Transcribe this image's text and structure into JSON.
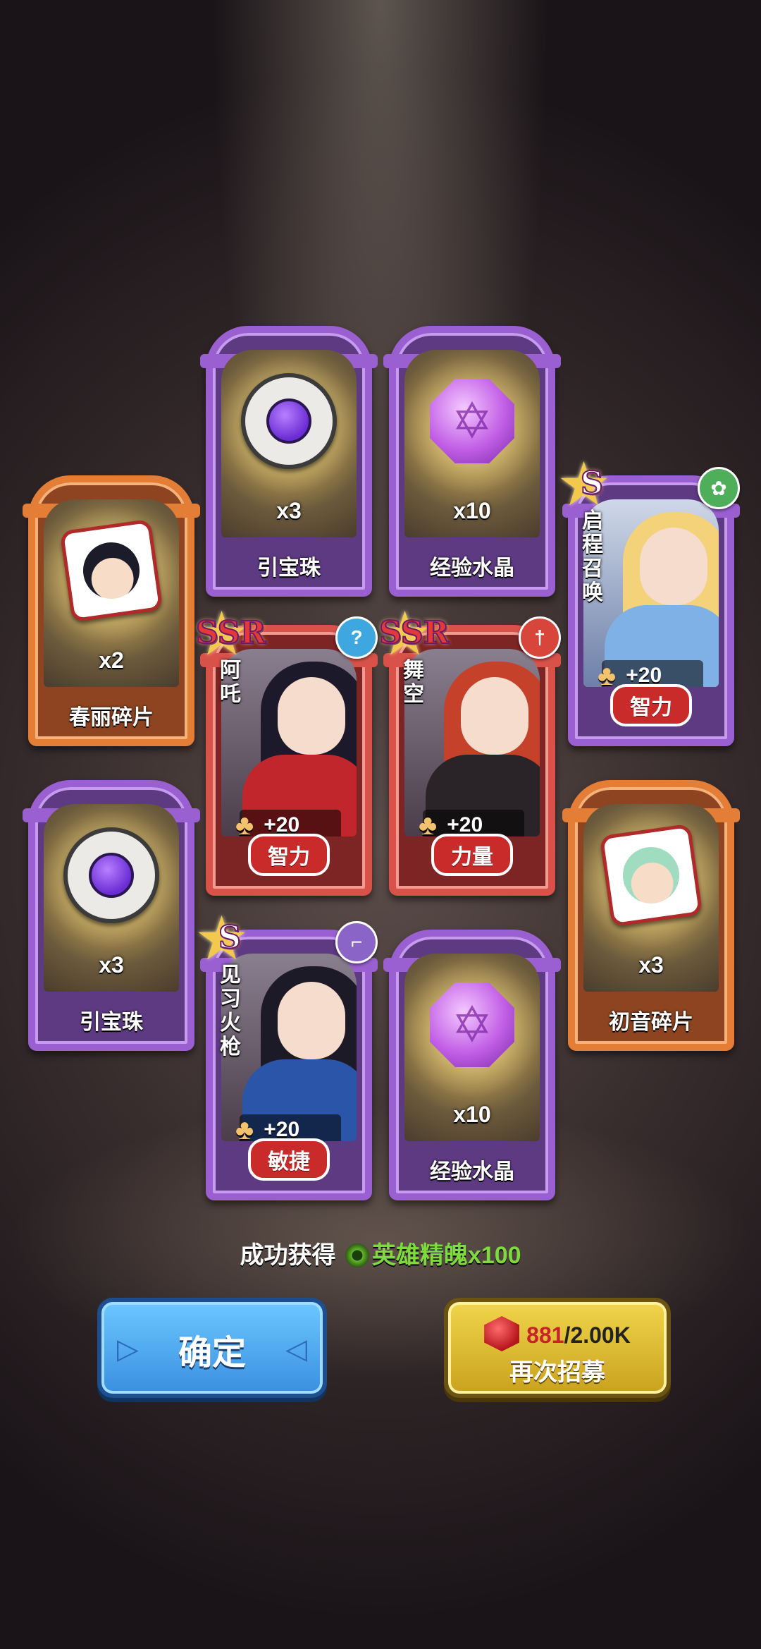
{
  "items": [
    {
      "label": "春丽碎片",
      "qty": "x2"
    },
    {
      "label": "引宝珠",
      "qty": "x3"
    },
    {
      "label": "经验水晶",
      "qty": "x10"
    },
    {
      "label": "引宝珠",
      "qty": "x3"
    },
    {
      "label": "初音碎片",
      "qty": "x3"
    },
    {
      "label": "经验水晶",
      "qty": "x10"
    }
  ],
  "heroes": [
    {
      "name": "启程召唤",
      "rank": "S",
      "power": "+20",
      "attribute": "智力",
      "class_icon": "lotus-icon"
    },
    {
      "name": "阿吒",
      "rank": "SSR",
      "power": "+20",
      "attribute": "智力",
      "class_icon": "question-icon"
    },
    {
      "name": "舞空",
      "rank": "SSR",
      "power": "+20",
      "attribute": "力量",
      "class_icon": "sword-icon"
    },
    {
      "name": "见习火枪",
      "rank": "S",
      "power": "+20",
      "attribute": "敏捷",
      "class_icon": "pistol-icon"
    }
  ],
  "footer": {
    "success_text": "成功获得",
    "reward_text": "英雄精魄x100"
  },
  "buttons": {
    "confirm": "确定",
    "recruit_again": "再次招募",
    "cost_current": "881",
    "cost_total": "/2.00K"
  }
}
